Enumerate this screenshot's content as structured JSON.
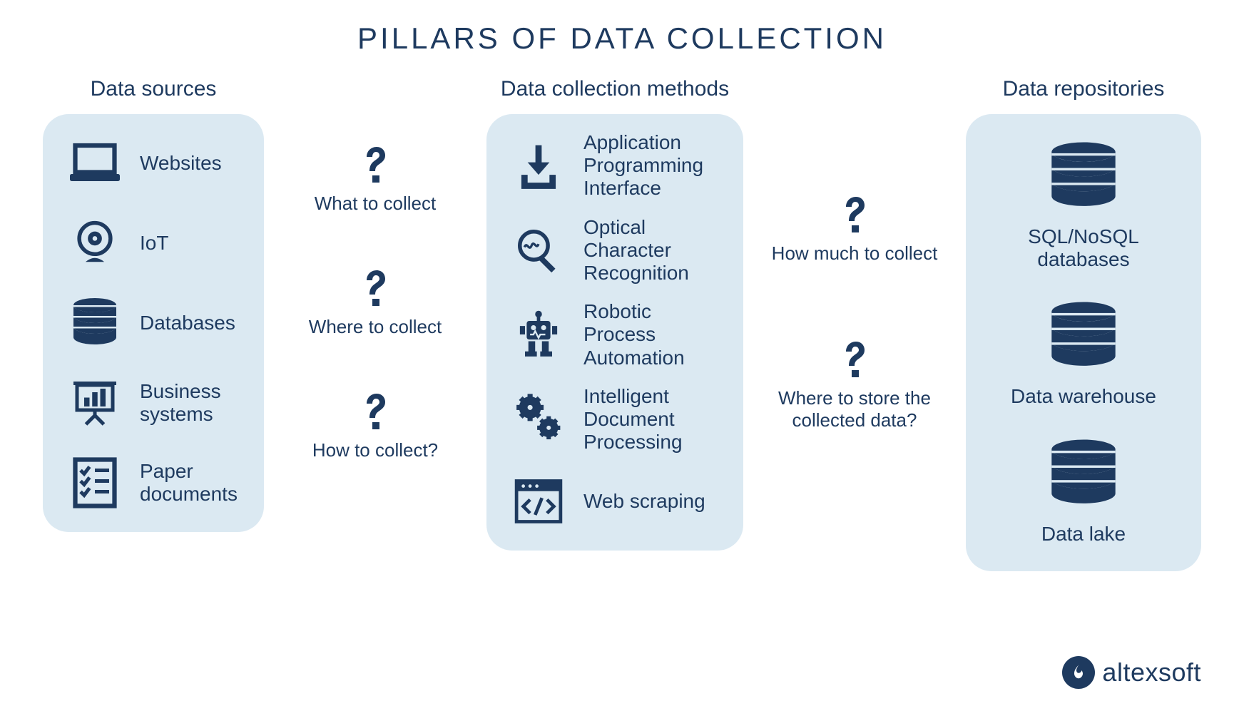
{
  "title": "PILLARS OF DATA COLLECTION",
  "columns": {
    "sources": {
      "title": "Data sources",
      "items": [
        {
          "label": "Websites"
        },
        {
          "label": "IoT"
        },
        {
          "label": "Databases"
        },
        {
          "label": "Business systems"
        },
        {
          "label": "Paper documents"
        }
      ]
    },
    "methods": {
      "title": "Data collection methods",
      "items": [
        {
          "label": "Application Programming Interface"
        },
        {
          "label": "Optical Character Recognition"
        },
        {
          "label": "Robotic Process Automation"
        },
        {
          "label": "Intelligent Document Processing"
        },
        {
          "label": "Web scraping"
        }
      ]
    },
    "repos": {
      "title": "Data repositories",
      "items": [
        {
          "label": "SQL/NoSQL databases"
        },
        {
          "label": "Data warehouse"
        },
        {
          "label": "Data lake"
        }
      ]
    }
  },
  "questions_left": [
    "What to collect",
    "Where to collect",
    "How to collect?"
  ],
  "questions_right": [
    "How much to collect",
    "Where to store the collected data?"
  ],
  "brand": "altexsoft"
}
